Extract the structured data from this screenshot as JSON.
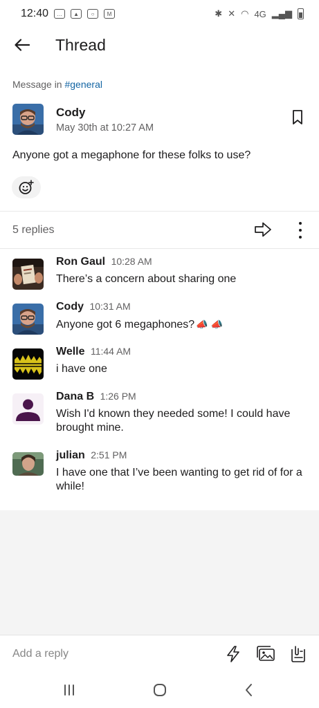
{
  "status": {
    "time": "12:40",
    "network": "4G"
  },
  "header": {
    "title": "Thread"
  },
  "parent": {
    "context_prefix": "Message in",
    "channel": "#general",
    "author": "Cody",
    "timestamp": "May 30th at 10:27 AM",
    "text": "Anyone got a megaphone for these folks to use?"
  },
  "replies_bar": {
    "count_label": "5 replies"
  },
  "replies": [
    {
      "name": "Ron Gaul",
      "time": "10:28 AM",
      "text": "There’s a concern about sharing one",
      "avatar": "photo-book"
    },
    {
      "name": "Cody",
      "time": "10:31 AM",
      "text": "Anyone got 6 megaphones?",
      "emoji": "📣 📣",
      "avatar": "photo-man-glasses"
    },
    {
      "name": "Welle",
      "time": "11:44 AM",
      "text": "i have one",
      "avatar": "yellow-waves-logo"
    },
    {
      "name": "Dana B",
      "time": "1:26 PM",
      "text": "Wish I'd known they needed some! I could have brought mine.",
      "avatar": "default-person"
    },
    {
      "name": "julian",
      "time": "2:51 PM",
      "text": "I have one that I’ve been wanting to get rid of for a while!",
      "avatar": "photo-portrait"
    }
  ],
  "composer": {
    "placeholder": "Add a reply"
  },
  "colors": {
    "link": "#1264a3",
    "text": "#1d1c1d",
    "muted": "#616061",
    "default_avatar": "#4a154b"
  }
}
